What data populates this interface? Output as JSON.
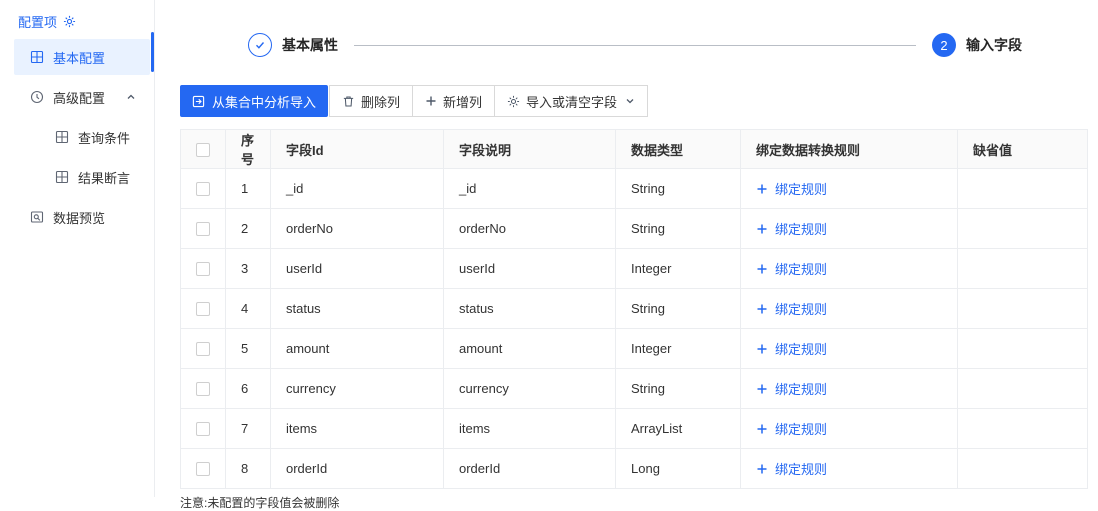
{
  "sidebar": {
    "title": "配置项",
    "items": [
      {
        "label": "基本配置",
        "active": true
      },
      {
        "label": "高级配置",
        "expanded": true
      },
      {
        "label": "查询条件"
      },
      {
        "label": "结果断言"
      },
      {
        "label": "数据预览"
      }
    ]
  },
  "stepper": {
    "steps": [
      {
        "label": "基本属性",
        "status": "finished"
      },
      {
        "label": "输入字段",
        "number": "2",
        "status": "current"
      }
    ]
  },
  "toolbar": {
    "analyze_import": "从集合中分析导入",
    "delete_column": "删除列",
    "add_column": "新增列",
    "import_or_clear": "导入或清空字段"
  },
  "table": {
    "headers": [
      "序号",
      "字段Id",
      "字段说明",
      "数据类型",
      "绑定数据转换规则",
      "缺省值"
    ],
    "bind_rule_label": "绑定规则",
    "rows": [
      {
        "no": "1",
        "field_id": "_id",
        "desc": "_id",
        "type": "String",
        "default": ""
      },
      {
        "no": "2",
        "field_id": "orderNo",
        "desc": "orderNo",
        "type": "String",
        "default": ""
      },
      {
        "no": "3",
        "field_id": "userId",
        "desc": "userId",
        "type": "Integer",
        "default": ""
      },
      {
        "no": "4",
        "field_id": "status",
        "desc": "status",
        "type": "String",
        "default": ""
      },
      {
        "no": "5",
        "field_id": "amount",
        "desc": "amount",
        "type": "Integer",
        "default": ""
      },
      {
        "no": "6",
        "field_id": "currency",
        "desc": "currency",
        "type": "String",
        "default": ""
      },
      {
        "no": "7",
        "field_id": "items",
        "desc": "items",
        "type": "ArrayList",
        "default": ""
      },
      {
        "no": "8",
        "field_id": "orderId",
        "desc": "orderId",
        "type": "Long",
        "default": ""
      }
    ]
  },
  "note": "注意:未配置的字段值会被删除",
  "colors": {
    "primary": "#2468f2",
    "sidebar_active_bg": "#e9f2ff",
    "table_header_bg": "#fafafa"
  }
}
